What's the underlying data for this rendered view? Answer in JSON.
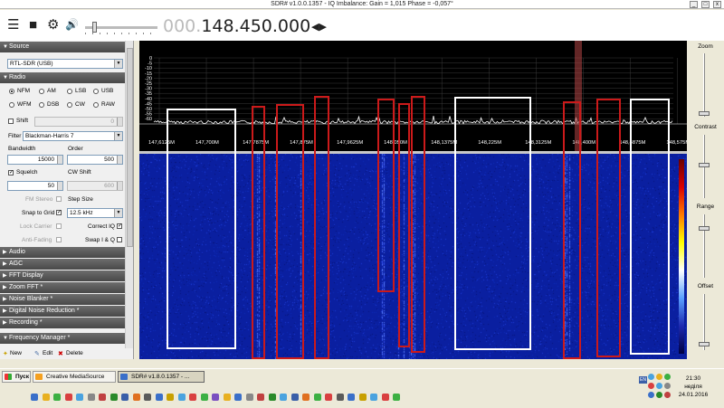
{
  "window": {
    "title": "SDR# v1.0.0.1357 - IQ Imbalance: Gain = 1,015 Phase = -0,057°",
    "minimize": "_",
    "maximize": "□",
    "close": "x"
  },
  "toolbar": {
    "menu_icon": "☰",
    "stop_icon": "■",
    "gear_icon": "⚙",
    "audio_icon": "🔊",
    "freq_prefix": "000.",
    "freq_main": "148.450.000",
    "freq_arrows": "◀▶"
  },
  "panel": {
    "source": {
      "header": "Source",
      "value": "RTL-SDR (USB)"
    },
    "radio": {
      "header": "Radio",
      "modes_row1": [
        "NFM",
        "AM",
        "LSB",
        "USB"
      ],
      "modes_row2": [
        "WFM",
        "DSB",
        "CW",
        "RAW"
      ],
      "selected_mode": "NFM",
      "shift_label": "Shift",
      "shift_value": "0",
      "filter_label": "Filter",
      "filter_value": "Blackman-Harris 7",
      "bandwidth_label": "Bandwidth",
      "bandwidth_value": "15000",
      "order_label": "Order",
      "order_value": "500",
      "squelch_label": "Squelch",
      "squelch_value": "50",
      "cwshift_label": "CW Shift",
      "cwshift_value": "600",
      "fm_stereo_label": "FM Stereo",
      "step_size_label": "Step Size",
      "snap_label": "Snap to Grid",
      "snap_value": "12.5 kHz",
      "lock_carrier_label": "Lock Carrier",
      "correct_iq_label": "Correct IQ",
      "anti_fading_label": "Anti-Fading",
      "swap_iq_label": "Swap I & Q"
    },
    "collapsed_sections": [
      "Audio",
      "AGC",
      "FFT Display",
      "Zoom FFT *",
      "Noise Blanker *",
      "Digital Noise Reduction *",
      "Recording *",
      "Frequency Manager *"
    ],
    "fm_buttons": {
      "new": "New",
      "edit": "Edit",
      "delete": "Delete"
    }
  },
  "spectrum": {
    "db_labels": [
      "0",
      "-5",
      "-10",
      "-15",
      "-20",
      "-25",
      "-30",
      "-35",
      "-40",
      "-45",
      "-50",
      "-55",
      "-60"
    ],
    "freq_labels": [
      "147,6125M",
      "147,700M",
      "147,7875M",
      "147,875M",
      "147,9625M",
      "148,050M",
      "148,1375M",
      "148,225M",
      "148,3125M",
      "148,400M",
      "148,4875M",
      "148,575M"
    ]
  },
  "right_panel": {
    "zoom_label": "Zoom",
    "contrast_label": "Contrast",
    "range_label": "Range",
    "offset_label": "Offset"
  },
  "taskbar": {
    "start_label": "Пуск",
    "tasks": [
      "Creative MediaSource",
      "SDR# v1.8.0.1357 - ..."
    ],
    "lang": "EN",
    "time": "21:30",
    "day": "неділя",
    "date": "24.01.2016"
  },
  "colors": {
    "panel_header": "#555555",
    "spectrum_bg": "#000000",
    "waterfall_bg": "#0a1fa0",
    "trace": "#ffffff",
    "highlight_white": "#ffffff",
    "highlight_red": "#cc1a1a"
  }
}
